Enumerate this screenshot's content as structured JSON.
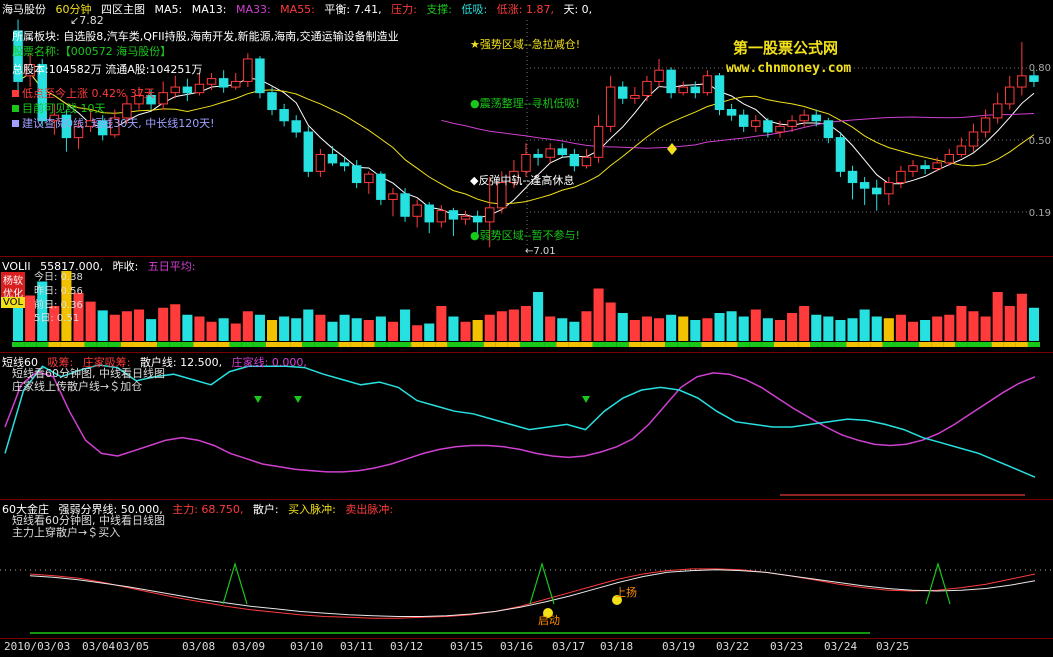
{
  "main_header": {
    "stock": "海马股份",
    "period": "60分钟",
    "view": "四区主图",
    "ma5": "MA5:",
    "ma13": "MA13:",
    "ma33": "MA33:",
    "ma55": "MA55:",
    "balance": "平衡: 7.41,",
    "pressure": "压力:",
    "support": "支撑:",
    "low": "低吸:",
    "low_rise": "低涨: 1.87,",
    "day": "天: 0,"
  },
  "info": {
    "sector": "所属板块: 自选股8,汽车类,QFII持股,海南开发,新能源,海南,交通运输设备制造业",
    "code": "股票名称:【000572 海马股份】",
    "shares": "总股本:104582万    流通A股:104251万",
    "low_state": "低点至今上涨 0.42%  37天",
    "target": "目前可见线 10天",
    "advice": "建议查阅0线: 短线30天, 中长线120天!"
  },
  "watermark": {
    "name": "第一股票公式网",
    "url": "www.chnmoney.com"
  },
  "zones": {
    "strong": "★强势区域--急拉减仓!",
    "shock": "●震荡整理--寻机低吸!",
    "rebound": "◆反弹中轨--逢高休息",
    "weak": "●弱势区域--暂不参与!"
  },
  "price_marks": {
    "high": "7.82",
    "low": "7.01"
  },
  "right_labels": [
    "0.80",
    "0.50",
    "0.19"
  ],
  "vol_header": {
    "name": "VOLII",
    "value": "55817.000,",
    "yesterday": "昨收:",
    "avg": "五日平均:"
  },
  "vol_side": {
    "badge1": "杨软",
    "badge2": "优化",
    "badge3": "VOL",
    "today": "今日: 0.38",
    "yest": "昨日: 0.56",
    "prev": "前日: 0.36",
    "avg": "5日: 0.51"
  },
  "ind1_header": {
    "name": "短线60",
    "a": "吸筹:",
    "b": "庄家吸筹:",
    "c": "散户线: 12.500,",
    "d": "庄家线: 0.000,"
  },
  "ind1_notes": [
    "短线看60分钟图, 中线看日线图",
    "庄家线上传散户线→＄加仓"
  ],
  "ind2_header": {
    "name": "60大金庄",
    "a": "强弱分界线: 50.000,",
    "b": "主力: 68.750,",
    "c": "散户:",
    "d": "买入脉冲:",
    "e": "卖出脉冲:"
  },
  "ind2_notes": [
    "短线看60分钟图, 中线看日线图",
    "主力上穿散户→＄买入"
  ],
  "ind2_marks": {
    "start": "启动",
    "rise": "上扬"
  },
  "x_ticks": [
    "2010/03/03",
    "03/04",
    "03/05",
    "03/08",
    "03/09",
    "03/10",
    "03/11",
    "03/12",
    "03/15",
    "03/16",
    "03/17",
    "03/18",
    "03/19",
    "03/22",
    "03/23",
    "03/24",
    "03/25"
  ],
  "colors": {
    "up": "#ff3b3b",
    "down": "#27e0e0",
    "ma": "#ffffff",
    "ma2": "#f2e11a",
    "ma3": "#d040d0",
    "green": "#19c819",
    "yellow": "#f2c200"
  },
  "chart_data": {
    "type": "candlestick",
    "candles": [
      {
        "o": 7.78,
        "c": 7.6,
        "h": 7.82,
        "l": 7.55
      },
      {
        "o": 7.62,
        "c": 7.66,
        "h": 7.7,
        "l": 7.58
      },
      {
        "o": 7.66,
        "c": 7.46,
        "h": 7.68,
        "l": 7.44
      },
      {
        "o": 7.46,
        "c": 7.48,
        "h": 7.52,
        "l": 7.41
      },
      {
        "o": 7.48,
        "c": 7.4,
        "h": 7.5,
        "l": 7.35
      },
      {
        "o": 7.4,
        "c": 7.44,
        "h": 7.46,
        "l": 7.36
      },
      {
        "o": 7.44,
        "c": 7.46,
        "h": 7.5,
        "l": 7.42
      },
      {
        "o": 7.46,
        "c": 7.41,
        "h": 7.48,
        "l": 7.39
      },
      {
        "o": 7.41,
        "c": 7.47,
        "h": 7.5,
        "l": 7.4
      },
      {
        "o": 7.47,
        "c": 7.52,
        "h": 7.55,
        "l": 7.45
      },
      {
        "o": 7.52,
        "c": 7.55,
        "h": 7.58,
        "l": 7.5
      },
      {
        "o": 7.55,
        "c": 7.52,
        "h": 7.57,
        "l": 7.5
      },
      {
        "o": 7.52,
        "c": 7.56,
        "h": 7.6,
        "l": 7.5
      },
      {
        "o": 7.56,
        "c": 7.58,
        "h": 7.62,
        "l": 7.54
      },
      {
        "o": 7.58,
        "c": 7.56,
        "h": 7.61,
        "l": 7.53
      },
      {
        "o": 7.56,
        "c": 7.59,
        "h": 7.63,
        "l": 7.55
      },
      {
        "o": 7.59,
        "c": 7.61,
        "h": 7.63,
        "l": 7.57
      },
      {
        "o": 7.61,
        "c": 7.58,
        "h": 7.64,
        "l": 7.56
      },
      {
        "o": 7.58,
        "c": 7.6,
        "h": 7.63,
        "l": 7.57
      },
      {
        "o": 7.6,
        "c": 7.68,
        "h": 7.7,
        "l": 7.58
      },
      {
        "o": 7.68,
        "c": 7.56,
        "h": 7.69,
        "l": 7.54
      },
      {
        "o": 7.56,
        "c": 7.5,
        "h": 7.58,
        "l": 7.48
      },
      {
        "o": 7.5,
        "c": 7.46,
        "h": 7.52,
        "l": 7.44
      },
      {
        "o": 7.46,
        "c": 7.42,
        "h": 7.48,
        "l": 7.4
      },
      {
        "o": 7.42,
        "c": 7.28,
        "h": 7.44,
        "l": 7.26
      },
      {
        "o": 7.28,
        "c": 7.34,
        "h": 7.36,
        "l": 7.26
      },
      {
        "o": 7.34,
        "c": 7.31,
        "h": 7.37,
        "l": 7.3
      },
      {
        "o": 7.31,
        "c": 7.3,
        "h": 7.33,
        "l": 7.28
      },
      {
        "o": 7.3,
        "c": 7.24,
        "h": 7.32,
        "l": 7.22
      },
      {
        "o": 7.24,
        "c": 7.27,
        "h": 7.28,
        "l": 7.2
      },
      {
        "o": 7.27,
        "c": 7.18,
        "h": 7.28,
        "l": 7.16
      },
      {
        "o": 7.18,
        "c": 7.2,
        "h": 7.22,
        "l": 7.12
      },
      {
        "o": 7.2,
        "c": 7.12,
        "h": 7.22,
        "l": 7.1
      },
      {
        "o": 7.12,
        "c": 7.16,
        "h": 7.18,
        "l": 7.08
      },
      {
        "o": 7.16,
        "c": 7.1,
        "h": 7.17,
        "l": 7.06
      },
      {
        "o": 7.1,
        "c": 7.14,
        "h": 7.16,
        "l": 7.08
      },
      {
        "o": 7.14,
        "c": 7.11,
        "h": 7.15,
        "l": 7.05
      },
      {
        "o": 7.11,
        "c": 7.12,
        "h": 7.14,
        "l": 7.09
      },
      {
        "o": 7.12,
        "c": 7.1,
        "h": 7.14,
        "l": 7.06
      },
      {
        "o": 7.1,
        "c": 7.15,
        "h": 7.26,
        "l": 7.01
      },
      {
        "o": 7.15,
        "c": 7.24,
        "h": 7.28,
        "l": 7.13
      },
      {
        "o": 7.24,
        "c": 7.28,
        "h": 7.32,
        "l": 7.22
      },
      {
        "o": 7.28,
        "c": 7.34,
        "h": 7.38,
        "l": 7.26
      },
      {
        "o": 7.34,
        "c": 7.33,
        "h": 7.36,
        "l": 7.3
      },
      {
        "o": 7.33,
        "c": 7.36,
        "h": 7.38,
        "l": 7.31
      },
      {
        "o": 7.36,
        "c": 7.34,
        "h": 7.38,
        "l": 7.33
      },
      {
        "o": 7.34,
        "c": 7.3,
        "h": 7.36,
        "l": 7.28
      },
      {
        "o": 7.3,
        "c": 7.33,
        "h": 7.36,
        "l": 7.29
      },
      {
        "o": 7.33,
        "c": 7.44,
        "h": 7.48,
        "l": 7.31
      },
      {
        "o": 7.44,
        "c": 7.58,
        "h": 7.62,
        "l": 7.42
      },
      {
        "o": 7.58,
        "c": 7.54,
        "h": 7.6,
        "l": 7.52
      },
      {
        "o": 7.54,
        "c": 7.55,
        "h": 7.58,
        "l": 7.52
      },
      {
        "o": 7.55,
        "c": 7.6,
        "h": 7.62,
        "l": 7.53
      },
      {
        "o": 7.6,
        "c": 7.64,
        "h": 7.68,
        "l": 7.58
      },
      {
        "o": 7.64,
        "c": 7.56,
        "h": 7.65,
        "l": 7.54
      },
      {
        "o": 7.56,
        "c": 7.58,
        "h": 7.6,
        "l": 7.55
      },
      {
        "o": 7.58,
        "c": 7.56,
        "h": 7.6,
        "l": 7.54
      },
      {
        "o": 7.56,
        "c": 7.62,
        "h": 7.64,
        "l": 7.55
      },
      {
        "o": 7.62,
        "c": 7.5,
        "h": 7.63,
        "l": 7.48
      },
      {
        "o": 7.5,
        "c": 7.48,
        "h": 7.52,
        "l": 7.46
      },
      {
        "o": 7.48,
        "c": 7.44,
        "h": 7.5,
        "l": 7.42
      },
      {
        "o": 7.44,
        "c": 7.46,
        "h": 7.48,
        "l": 7.42
      },
      {
        "o": 7.46,
        "c": 7.42,
        "h": 7.47,
        "l": 7.4
      },
      {
        "o": 7.42,
        "c": 7.44,
        "h": 7.46,
        "l": 7.4
      },
      {
        "o": 7.44,
        "c": 7.46,
        "h": 7.48,
        "l": 7.42
      },
      {
        "o": 7.46,
        "c": 7.48,
        "h": 7.5,
        "l": 7.44
      },
      {
        "o": 7.48,
        "c": 7.46,
        "h": 7.5,
        "l": 7.44
      },
      {
        "o": 7.46,
        "c": 7.4,
        "h": 7.47,
        "l": 7.38
      },
      {
        "o": 7.4,
        "c": 7.28,
        "h": 7.42,
        "l": 7.26
      },
      {
        "o": 7.28,
        "c": 7.24,
        "h": 7.3,
        "l": 7.18
      },
      {
        "o": 7.24,
        "c": 7.22,
        "h": 7.26,
        "l": 7.16
      },
      {
        "o": 7.22,
        "c": 7.2,
        "h": 7.25,
        "l": 7.14
      },
      {
        "o": 7.2,
        "c": 7.24,
        "h": 7.26,
        "l": 7.16
      },
      {
        "o": 7.24,
        "c": 7.28,
        "h": 7.3,
        "l": 7.22
      },
      {
        "o": 7.28,
        "c": 7.3,
        "h": 7.32,
        "l": 7.26
      },
      {
        "o": 7.3,
        "c": 7.29,
        "h": 7.32,
        "l": 7.27
      },
      {
        "o": 7.29,
        "c": 7.31,
        "h": 7.33,
        "l": 7.28
      },
      {
        "o": 7.31,
        "c": 7.34,
        "h": 7.36,
        "l": 7.3
      },
      {
        "o": 7.34,
        "c": 7.37,
        "h": 7.4,
        "l": 7.33
      },
      {
        "o": 7.37,
        "c": 7.42,
        "h": 7.45,
        "l": 7.35
      },
      {
        "o": 7.42,
        "c": 7.47,
        "h": 7.5,
        "l": 7.4
      },
      {
        "o": 7.47,
        "c": 7.52,
        "h": 7.56,
        "l": 7.45
      },
      {
        "o": 7.52,
        "c": 7.58,
        "h": 7.62,
        "l": 7.5
      },
      {
        "o": 7.58,
        "c": 7.62,
        "h": 7.74,
        "l": 7.55
      },
      {
        "o": 7.62,
        "c": 7.6,
        "h": 7.64,
        "l": 7.58
      }
    ],
    "volume": [
      0.6,
      0.52,
      0.68,
      0.4,
      0.8,
      0.55,
      0.45,
      0.35,
      0.3,
      0.34,
      0.36,
      0.25,
      0.38,
      0.42,
      0.3,
      0.28,
      0.22,
      0.26,
      0.2,
      0.34,
      0.3,
      0.24,
      0.28,
      0.26,
      0.36,
      0.3,
      0.22,
      0.3,
      0.26,
      0.24,
      0.28,
      0.22,
      0.36,
      0.18,
      0.2,
      0.4,
      0.28,
      0.22,
      0.24,
      0.3,
      0.34,
      0.36,
      0.4,
      0.56,
      0.28,
      0.26,
      0.22,
      0.34,
      0.6,
      0.44,
      0.32,
      0.24,
      0.28,
      0.26,
      0.3,
      0.28,
      0.24,
      0.26,
      0.32,
      0.34,
      0.28,
      0.36,
      0.26,
      0.24,
      0.32,
      0.4,
      0.3,
      0.28,
      0.24,
      0.26,
      0.36,
      0.28,
      0.26,
      0.3,
      0.22,
      0.24,
      0.28,
      0.3,
      0.4,
      0.34,
      0.28,
      0.56,
      0.4,
      0.54,
      0.38
    ],
    "ind1_retail": [
      0.5,
      0.82,
      0.92,
      0.88,
      0.62,
      0.4,
      0.3,
      0.28,
      0.32,
      0.36,
      0.4,
      0.42,
      0.4,
      0.36,
      0.3,
      0.26,
      0.22,
      0.2,
      0.18,
      0.17,
      0.16,
      0.16,
      0.17,
      0.19,
      0.22,
      0.26,
      0.3,
      0.33,
      0.35,
      0.36,
      0.36,
      0.35,
      0.33,
      0.3,
      0.28,
      0.27,
      0.28,
      0.31,
      0.35,
      0.41,
      0.52,
      0.66,
      0.8,
      0.88,
      0.91,
      0.9,
      0.86,
      0.8,
      0.72,
      0.64,
      0.57,
      0.5,
      0.44,
      0.4,
      0.37,
      0.36,
      0.37,
      0.4,
      0.45,
      0.52,
      0.6,
      0.68,
      0.76,
      0.83,
      0.88
    ],
    "ind1_dealer": [
      0.3,
      0.78,
      0.96,
      0.88,
      0.93,
      0.97,
      0.95,
      0.85,
      0.88,
      0.9,
      0.86,
      0.82,
      0.92,
      0.96,
      0.96,
      0.96,
      0.95,
      0.9,
      0.86,
      0.82,
      0.84,
      0.8,
      0.7,
      0.66,
      0.62,
      0.6,
      0.56,
      0.52,
      0.48,
      0.5,
      0.52,
      0.48,
      0.62,
      0.72,
      0.78,
      0.8,
      0.78,
      0.72,
      0.62,
      0.54,
      0.52,
      0.5,
      0.5,
      0.52,
      0.54,
      0.56,
      0.55,
      0.52,
      0.48,
      0.42,
      0.38,
      0.34,
      0.3,
      0.24,
      0.18,
      0.12
    ],
    "ind2_main": [
      0.6,
      0.58,
      0.55,
      0.5,
      0.44,
      0.38,
      0.32,
      0.27,
      0.22,
      0.18,
      0.15,
      0.12,
      0.1,
      0.09,
      0.08,
      0.08,
      0.09,
      0.1,
      0.12,
      0.16,
      0.22,
      0.3,
      0.38,
      0.46,
      0.54,
      0.6,
      0.64,
      0.66,
      0.66,
      0.65,
      0.62,
      0.58,
      0.53,
      0.48,
      0.44,
      0.41,
      0.4,
      0.41,
      0.44,
      0.48,
      0.54,
      0.6
    ],
    "ind2_retail": [
      0.58,
      0.56,
      0.53,
      0.49,
      0.45,
      0.4,
      0.35,
      0.3,
      0.26,
      0.22,
      0.19,
      0.16,
      0.14,
      0.12,
      0.11,
      0.1,
      0.1,
      0.11,
      0.13,
      0.16,
      0.21,
      0.27,
      0.34,
      0.42,
      0.5,
      0.57,
      0.62,
      0.64,
      0.65,
      0.64,
      0.62,
      0.58,
      0.54,
      0.5,
      0.46,
      0.43,
      0.41,
      0.4,
      0.41,
      0.43,
      0.47,
      0.52
    ]
  }
}
